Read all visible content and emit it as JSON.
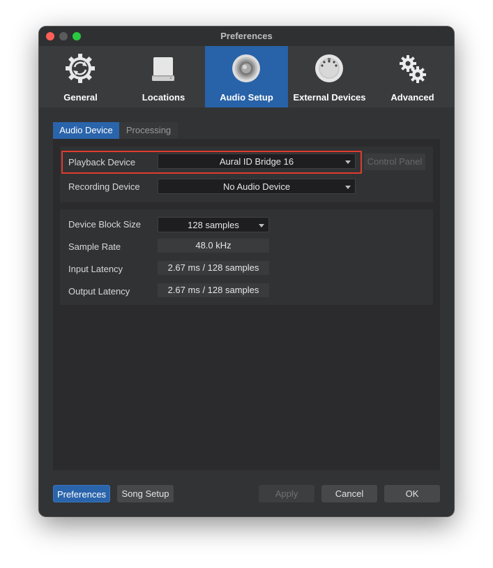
{
  "window": {
    "title": "Preferences"
  },
  "toolbar": {
    "items": [
      {
        "label": "General",
        "icon": "gear-sync-icon"
      },
      {
        "label": "Locations",
        "icon": "drive-icon"
      },
      {
        "label": "Audio Setup",
        "icon": "speaker-icon"
      },
      {
        "label": "External Devices",
        "icon": "midi-connector-icon"
      },
      {
        "label": "Advanced",
        "icon": "gears-icon"
      }
    ],
    "active_index": 2
  },
  "tabs": {
    "items": [
      "Audio Device",
      "Processing"
    ],
    "active_index": 0
  },
  "device": {
    "playback_label": "Playback Device",
    "playback_value": "Aural ID Bridge 16",
    "control_panel_label": "Control Panel",
    "recording_label": "Recording Device",
    "recording_value": "No Audio Device"
  },
  "settings": {
    "block_size_label": "Device Block Size",
    "block_size_value": "128 samples",
    "sample_rate_label": "Sample Rate",
    "sample_rate_value": "48.0 kHz",
    "input_latency_label": "Input Latency",
    "input_latency_value": "2.67 ms / 128 samples",
    "output_latency_label": "Output Latency",
    "output_latency_value": "2.67 ms / 128 samples"
  },
  "footer": {
    "preferences_label": "Preferences",
    "song_setup_label": "Song Setup",
    "apply_label": "Apply",
    "cancel_label": "Cancel",
    "ok_label": "OK"
  },
  "colors": {
    "accent": "#2a64ab",
    "highlight": "#e03b2e"
  }
}
